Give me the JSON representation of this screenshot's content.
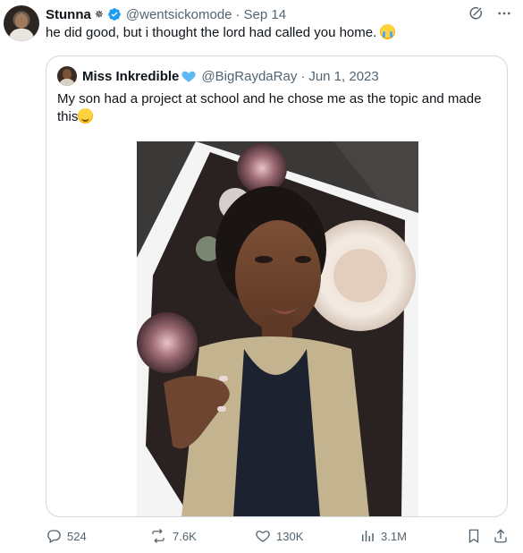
{
  "tweet": {
    "display_name": "Stunna",
    "emblem": "✵",
    "handle": "@wentsickomode",
    "separator": "·",
    "date": "Sep 14",
    "text": "he did good, but i thought the lord had called you home.",
    "emoji": "loudly-crying-face"
  },
  "quote": {
    "display_name": "Miss Inkredible",
    "handle": "@BigRaydaRay",
    "separator": "·",
    "date": "Jun 1, 2023",
    "text": "My son had a project at school and he chose me as the topic and made this",
    "emoji": "smiling-face-with-tear"
  },
  "metrics": {
    "replies": "524",
    "reposts": "7.6K",
    "likes": "130K",
    "views": "3.1M"
  },
  "colors": {
    "text": "#0f1419",
    "secondary": "#536471",
    "verified": "#1d9bf0",
    "border": "#cfd9de",
    "heart_badge": "#5fb7f4"
  },
  "icons": [
    "verified-badge-icon",
    "grok-icon",
    "more-icon",
    "blue-heart-icon",
    "reply-icon",
    "repost-icon",
    "like-icon",
    "views-icon",
    "bookmark-icon",
    "share-icon"
  ]
}
